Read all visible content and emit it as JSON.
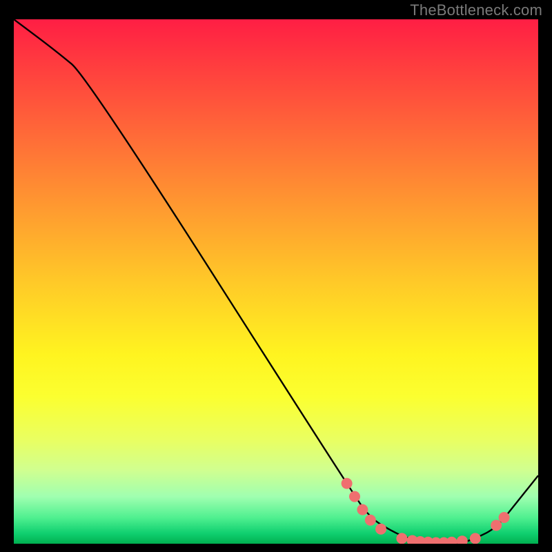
{
  "watermark": {
    "text": "TheBottleneck.com"
  },
  "chart_data": {
    "type": "line",
    "title": "",
    "xlabel": "",
    "ylabel": "",
    "xlim": [
      0,
      100
    ],
    "ylim": [
      0,
      100
    ],
    "grid": false,
    "legend": false,
    "series": [
      {
        "name": "curve",
        "x": [
          0,
          8,
          14,
          65,
          68,
          71,
          75,
          80,
          85,
          88,
          92,
          96,
          100
        ],
        "y": [
          100,
          94,
          89,
          9,
          5,
          3,
          1,
          0,
          0,
          1,
          3,
          8,
          13
        ],
        "color": "#000000"
      }
    ],
    "markers": [
      {
        "name": "highlight-dot",
        "x": 63.5,
        "y": 11.5,
        "color": "#ef6f6f"
      },
      {
        "name": "highlight-dot",
        "x": 65.0,
        "y": 9.0,
        "color": "#ef6f6f"
      },
      {
        "name": "highlight-dot",
        "x": 66.5,
        "y": 6.5,
        "color": "#ef6f6f"
      },
      {
        "name": "highlight-dot",
        "x": 68.0,
        "y": 4.5,
        "color": "#ef6f6f"
      },
      {
        "name": "highlight-dot",
        "x": 70.0,
        "y": 2.8,
        "color": "#ef6f6f"
      },
      {
        "name": "highlight-dot",
        "x": 74.0,
        "y": 1.0,
        "color": "#ef6f6f"
      },
      {
        "name": "highlight-dot",
        "x": 76.0,
        "y": 0.6,
        "color": "#ef6f6f"
      },
      {
        "name": "highlight-dot",
        "x": 77.5,
        "y": 0.4,
        "color": "#ef6f6f"
      },
      {
        "name": "highlight-dot",
        "x": 79.0,
        "y": 0.3,
        "color": "#ef6f6f"
      },
      {
        "name": "highlight-dot",
        "x": 80.5,
        "y": 0.2,
        "color": "#ef6f6f"
      },
      {
        "name": "highlight-dot",
        "x": 82.0,
        "y": 0.2,
        "color": "#ef6f6f"
      },
      {
        "name": "highlight-dot",
        "x": 83.5,
        "y": 0.3,
        "color": "#ef6f6f"
      },
      {
        "name": "highlight-dot",
        "x": 85.5,
        "y": 0.5,
        "color": "#ef6f6f"
      },
      {
        "name": "highlight-dot",
        "x": 88.0,
        "y": 1.0,
        "color": "#ef6f6f"
      },
      {
        "name": "highlight-dot",
        "x": 92.0,
        "y": 3.5,
        "color": "#ef6f6f"
      },
      {
        "name": "highlight-dot",
        "x": 93.5,
        "y": 5.0,
        "color": "#ef6f6f"
      }
    ]
  }
}
